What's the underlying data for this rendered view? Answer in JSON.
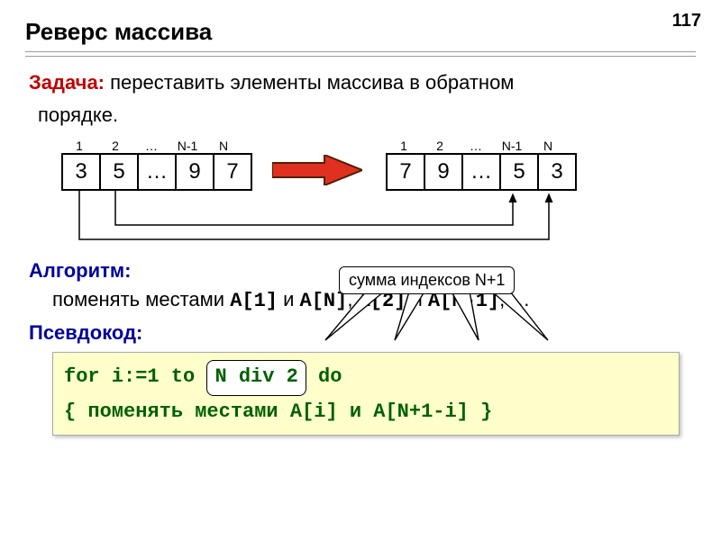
{
  "page_number": "117",
  "title": "Реверс массива",
  "task": {
    "label": "Задача:",
    "text_line1": "переставить элементы массива в обратном",
    "text_line2": "порядке."
  },
  "arrays": {
    "labels": [
      "1",
      "2",
      "…",
      "N-1",
      "N"
    ],
    "before": [
      "3",
      "5",
      "…",
      "9",
      "7"
    ],
    "after": [
      "7",
      "9",
      "…",
      "5",
      "3"
    ]
  },
  "callout": "сумма индексов N+1",
  "algorithm": {
    "heading": "Алгоритм:",
    "text_prefix": "поменять местами ",
    "pair1_a": "A[1]",
    "and": " и ",
    "pair1_b": "A[N]",
    "sep": ", ",
    "pair2_a": "A[2]",
    "pair2_b": "A[N-1]",
    "trail": ", …"
  },
  "pseudocode": {
    "heading": "Псевдокод:",
    "line1_a": "for i:=1 to ",
    "pill": "N div 2",
    "line1_b": " do",
    "line2": " { поменять местами A[i] и A[N+1-i] }"
  }
}
